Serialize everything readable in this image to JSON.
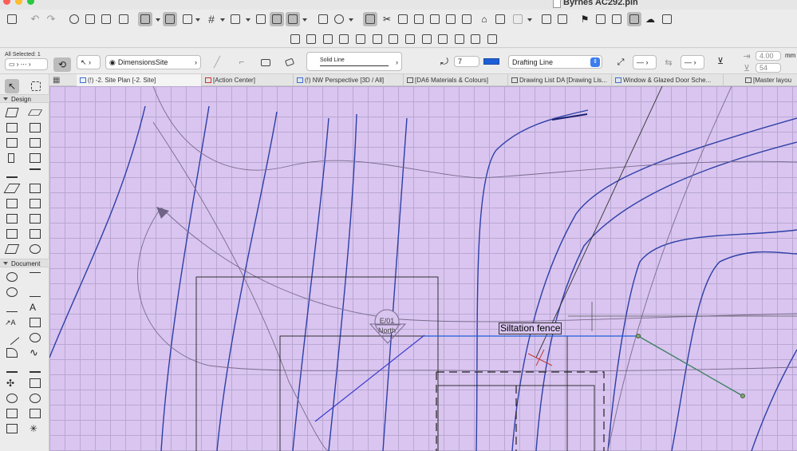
{
  "window": {
    "title": "Byrnes AC292.pln"
  },
  "colors": {
    "canvas": "#d9c5ef",
    "grid": "#b9a7d3",
    "blue_line": "#2d3fa8",
    "green_line": "#3d8060",
    "accent": "#1f5fd6"
  },
  "infobox": {
    "all_selected": "All Selected: 1",
    "layer": "DimensionsSite",
    "line_type": "Solid Line",
    "pen_number": "7",
    "line_category": "Drafting Line",
    "value_top": "4.00",
    "unit": "mm",
    "value_bottom": "54"
  },
  "tabs": [
    {
      "label": "(!) -2. Site Plan  [-2. Site]"
    },
    {
      "label": "[Action Center]"
    },
    {
      "label": "(!) NW Perspective [3D / All]"
    },
    {
      "label": "[DA6 Materials & Colours]"
    },
    {
      "label": "Drawing List DA [Drawing Lis..."
    },
    {
      "label": "Window & Glazed Door Sche..."
    },
    {
      "label": "[Master layou"
    }
  ],
  "toolbox": {
    "design_label": "Design",
    "document_label": "Document"
  },
  "canvas": {
    "annotation": "Siltation fence",
    "marker_ref": "E/01",
    "marker_label": "North"
  }
}
